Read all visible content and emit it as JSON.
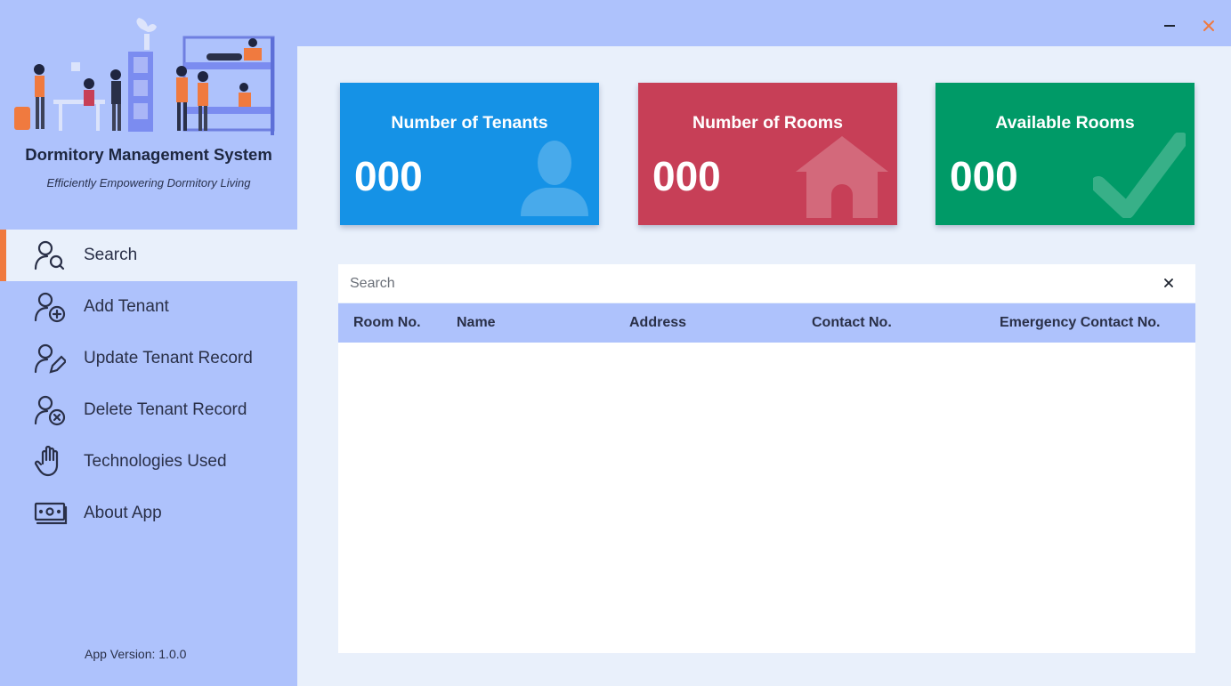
{
  "window": {
    "minimize_icon": "minimize-icon",
    "close_icon": "close-icon",
    "close_color": "#f07a3f"
  },
  "sidebar": {
    "title": "Dormitory Management System",
    "subtitle": "Efficiently Empowering Dormitory Living",
    "version": "App Version: 1.0.0",
    "active_accent": "#f07a3f",
    "items": [
      {
        "label": "Search",
        "icon": "user-search-icon",
        "active": true
      },
      {
        "label": "Add Tenant",
        "icon": "user-add-icon",
        "active": false
      },
      {
        "label": "Update Tenant Record",
        "icon": "user-edit-icon",
        "active": false
      },
      {
        "label": "Delete Tenant Record",
        "icon": "user-delete-icon",
        "active": false
      },
      {
        "label": "Technologies Used",
        "icon": "hand-icon",
        "active": false
      },
      {
        "label": "About App",
        "icon": "money-icon",
        "active": false
      }
    ]
  },
  "stats": [
    {
      "title": "Number of Tenants",
      "value": "000",
      "color": "#1592e6",
      "icon": "person-icon"
    },
    {
      "title": "Number of Rooms",
      "value": "000",
      "color": "#c73f57",
      "icon": "house-icon"
    },
    {
      "title": "Available Rooms",
      "value": "000",
      "color": "#009a67",
      "icon": "checkmark-icon"
    }
  ],
  "search": {
    "placeholder": "Search",
    "value": ""
  },
  "table": {
    "columns": [
      "Room No.",
      "Name",
      "Address",
      "Contact No.",
      "Emergency Contact No."
    ],
    "rows": []
  }
}
